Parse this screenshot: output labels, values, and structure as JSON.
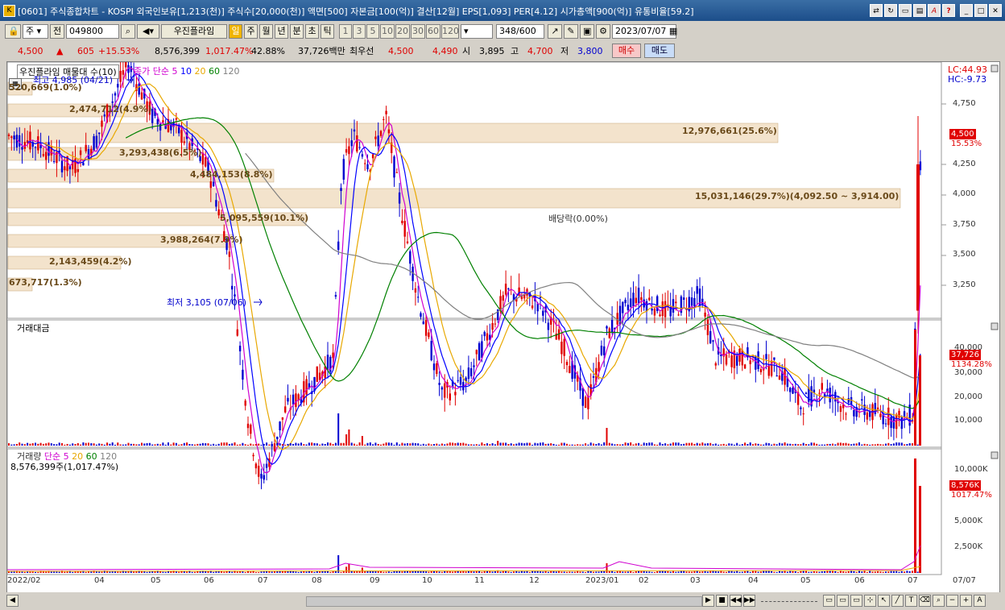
{
  "window": {
    "title": "[0601] 주식종합차트 - KOSPI 외국인보유[1,213(천)] 주식수[20,000(천)] 액면[500] 자본금[100(억)] 결산[12월] EPS[1,093] PER[4.12] 시가총액[900(억)] 유통비율[59.2]",
    "icon": "app-icon"
  },
  "toolbar": {
    "market": "주",
    "prev_label": "전",
    "code": "049800",
    "name": "우진플라임",
    "periods": [
      "일",
      "주",
      "월",
      "년",
      "분",
      "초",
      "틱"
    ],
    "active_period": "일",
    "intervals": [
      "1",
      "3",
      "5",
      "10",
      "20",
      "30",
      "60",
      "120"
    ],
    "count": "348",
    "max_count": "/600",
    "date": "2023/07/07"
  },
  "quote": {
    "price": "4,500",
    "change": "605",
    "change_pct": "+15.53%",
    "volume": "8,576,399",
    "volume_pct": "1,017.47%",
    "turnover_pct": "42.88%",
    "amount": "37,726백만",
    "best_ask_label": "최우선",
    "best_ask": "4,500",
    "best_bid": "4,490",
    "open_label": "시",
    "open": "3,895",
    "high_label": "고",
    "high": "4,700",
    "low_label": "저",
    "low": "3,800",
    "buy_label": "매수",
    "sell_label": "매도"
  },
  "price_panel": {
    "legend_title": "우진플라임 매물대 수(10)",
    "ma_legend": [
      "종가 단순 5",
      "10",
      "20",
      "60",
      "120"
    ],
    "high_marker": "최고 4,985 (04/21)",
    "low_marker": "최저 3,105 (07/06)",
    "dividend_marker": "배당락(0.00%)",
    "lc": "LC:44.93",
    "hc": "HC:-9.73",
    "last_price": "4,500",
    "last_pct": "15.53%",
    "y_ticks": [
      "4,750",
      "4,500",
      "4,250",
      "4,000",
      "3,750",
      "3,500",
      "3,250"
    ],
    "volume_profile": [
      "673,717(1.3%)",
      "2,143,459(4.2%)",
      "3,988,264(7.9%)",
      "5,095,559(10.1%)",
      "4,484,153(8.8%)",
      "3,293,438(6.5%)",
      "2,474,712(4.9%)",
      "520,669(1.0%)",
      "12,976,661(25.6%)",
      "15,031,146(29.7%)(4,092.50 ~ 3,914.00)"
    ]
  },
  "amount_panel": {
    "title": "거래대금",
    "last": "37,726",
    "last_pct": "1134.28%",
    "y_ticks": [
      "40,000",
      "30,000",
      "20,000",
      "10,000"
    ]
  },
  "volume_panel": {
    "title": "거래량",
    "legend": [
      "단순 5",
      "20",
      "60",
      "120"
    ],
    "sub": "8,576,399주(1,017.47%)",
    "last": "8,576K",
    "last_pct": "1017.47%",
    "y_ticks": [
      "10,000K",
      "7,500K",
      "5,000K",
      "2,500K"
    ]
  },
  "x_axis": [
    "2022/02",
    "04",
    "05",
    "06",
    "07",
    "08",
    "09",
    "10",
    "11",
    "12",
    "2023/01",
    "02",
    "03",
    "04",
    "05",
    "06",
    "07",
    "07/07"
  ],
  "colors": {
    "up": "#e00000",
    "down": "#0000d0",
    "profile": "#f3e3cc",
    "ma5": "#d000d0",
    "ma10": "#0000ff",
    "ma20": "#e8a800",
    "ma60": "#008000",
    "ma120": "#808080"
  }
}
